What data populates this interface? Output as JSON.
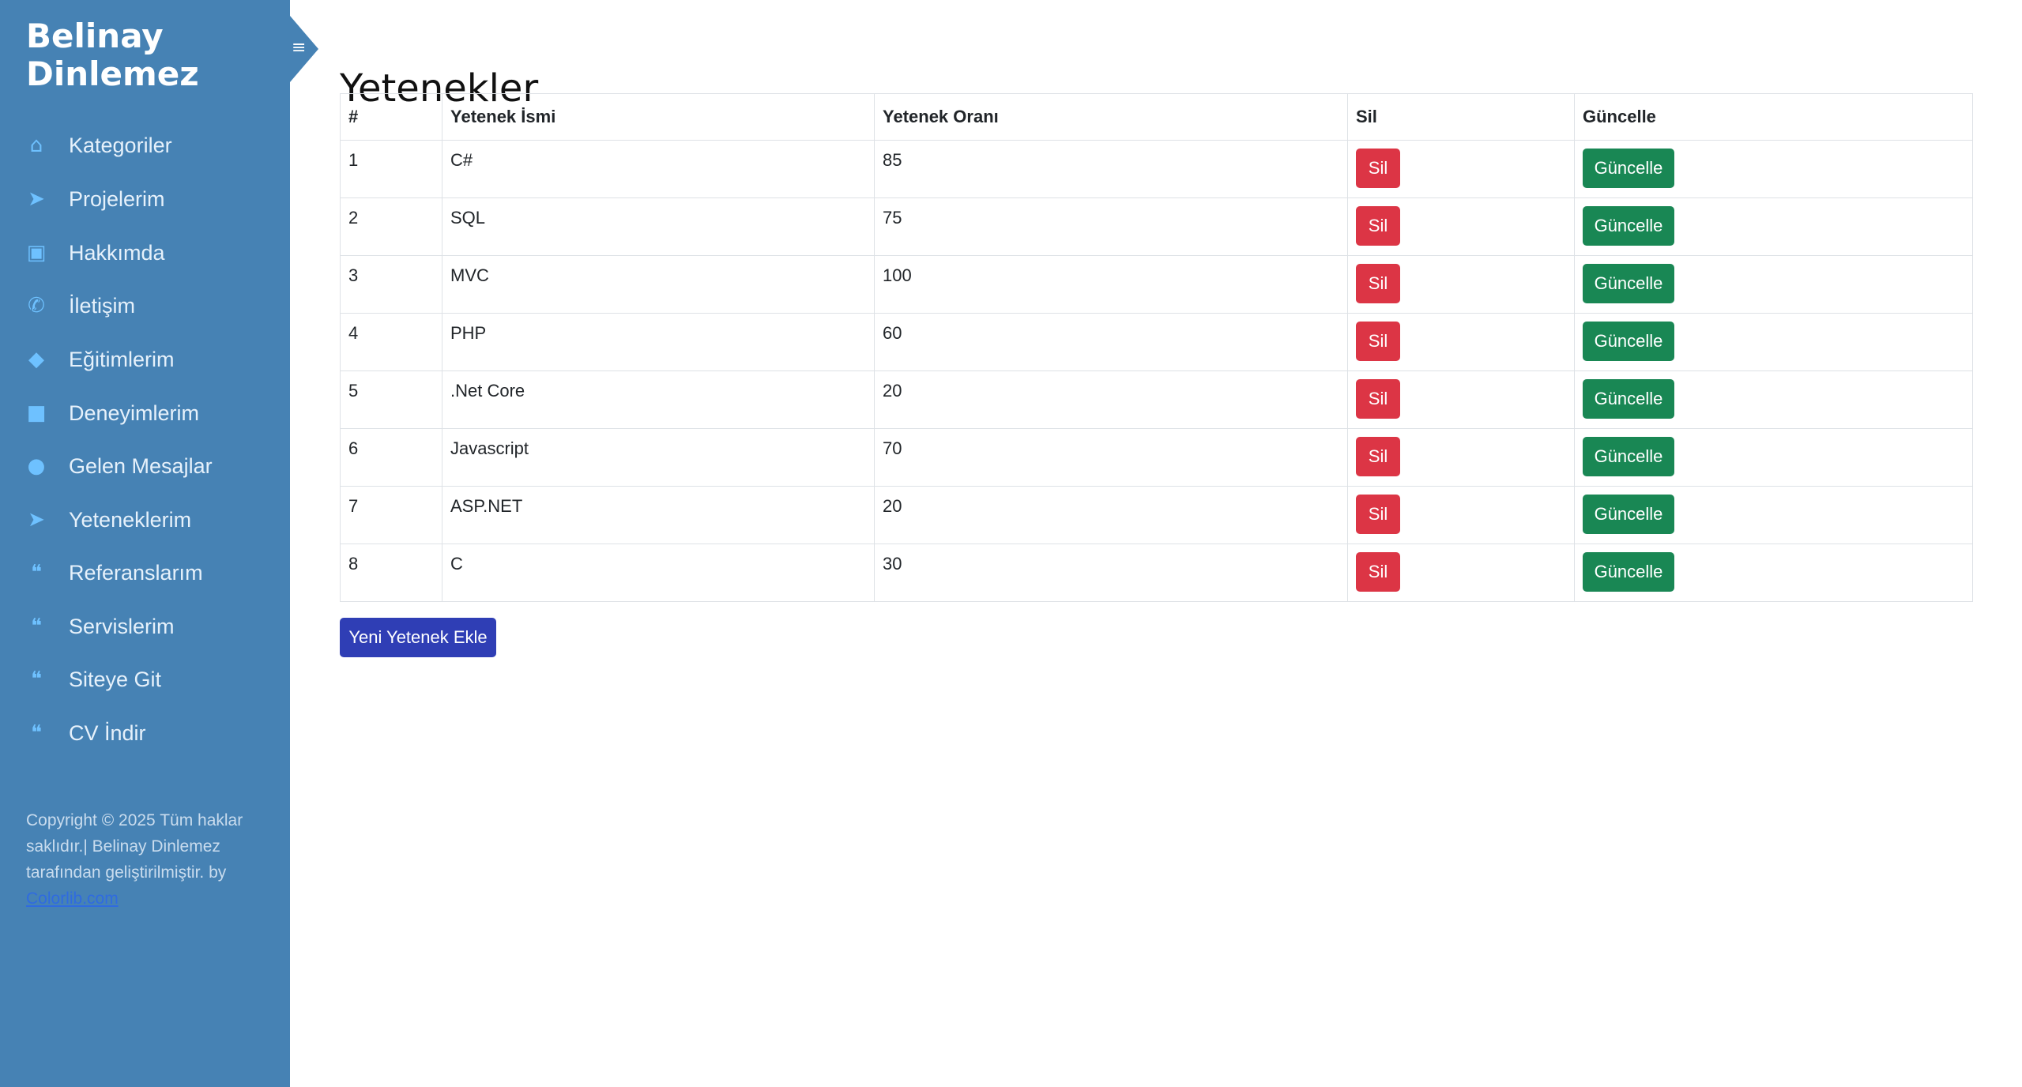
{
  "sidebar": {
    "brand_line1": "Belinay",
    "brand_line2": "Dinlemez",
    "items": [
      {
        "label": "Kategoriler",
        "icon": "home-icon"
      },
      {
        "label": "Projelerim",
        "icon": "paper-plane-icon"
      },
      {
        "label": "Hakkımda",
        "icon": "image-icon"
      },
      {
        "label": "İletişim",
        "icon": "phone-icon"
      },
      {
        "label": "Eğitimlerim",
        "icon": "graduation-cap-icon"
      },
      {
        "label": "Deneyimlerim",
        "icon": "briefcase-icon"
      },
      {
        "label": "Gelen Mesajlar",
        "icon": "comment-icon"
      },
      {
        "label": "Yeteneklerim",
        "icon": "paper-plane-icon"
      },
      {
        "label": "Referanslarım",
        "icon": "quote-icon"
      },
      {
        "label": "Servislerim",
        "icon": "quote-icon"
      },
      {
        "label": "Siteye Git",
        "icon": "quote-icon"
      },
      {
        "label": "CV İndir",
        "icon": "quote-icon"
      }
    ],
    "footer_text": "Copyright © 2025 Tüm haklar saklıdır.| Belinay Dinlemez tarafından geliştirilmiştir. by",
    "footer_link": "Colorlib.com"
  },
  "main": {
    "title": "Yetenekler",
    "table": {
      "headers": [
        "#",
        "Yetenek İsmi",
        "Yetenek Oranı",
        "Sil",
        "Güncelle"
      ],
      "rows": [
        {
          "id": "1",
          "name": "C#",
          "rate": "85"
        },
        {
          "id": "2",
          "name": "SQL",
          "rate": "75"
        },
        {
          "id": "3",
          "name": "MVC",
          "rate": "100"
        },
        {
          "id": "4",
          "name": "PHP",
          "rate": "60"
        },
        {
          "id": "5",
          "name": ".Net Core",
          "rate": "20"
        },
        {
          "id": "6",
          "name": "Javascript",
          "rate": "70"
        },
        {
          "id": "7",
          "name": "ASP.NET",
          "rate": "20"
        },
        {
          "id": "8",
          "name": "C",
          "rate": "30"
        }
      ],
      "delete_label": "Sil",
      "update_label": "Güncelle"
    },
    "add_button_label": "Yeni Yetenek Ekle"
  },
  "colors": {
    "sidebar_bg": "#4682b4",
    "delete_button": "#dc3545",
    "update_button": "#198754",
    "add_button": "#2f3eb5"
  }
}
